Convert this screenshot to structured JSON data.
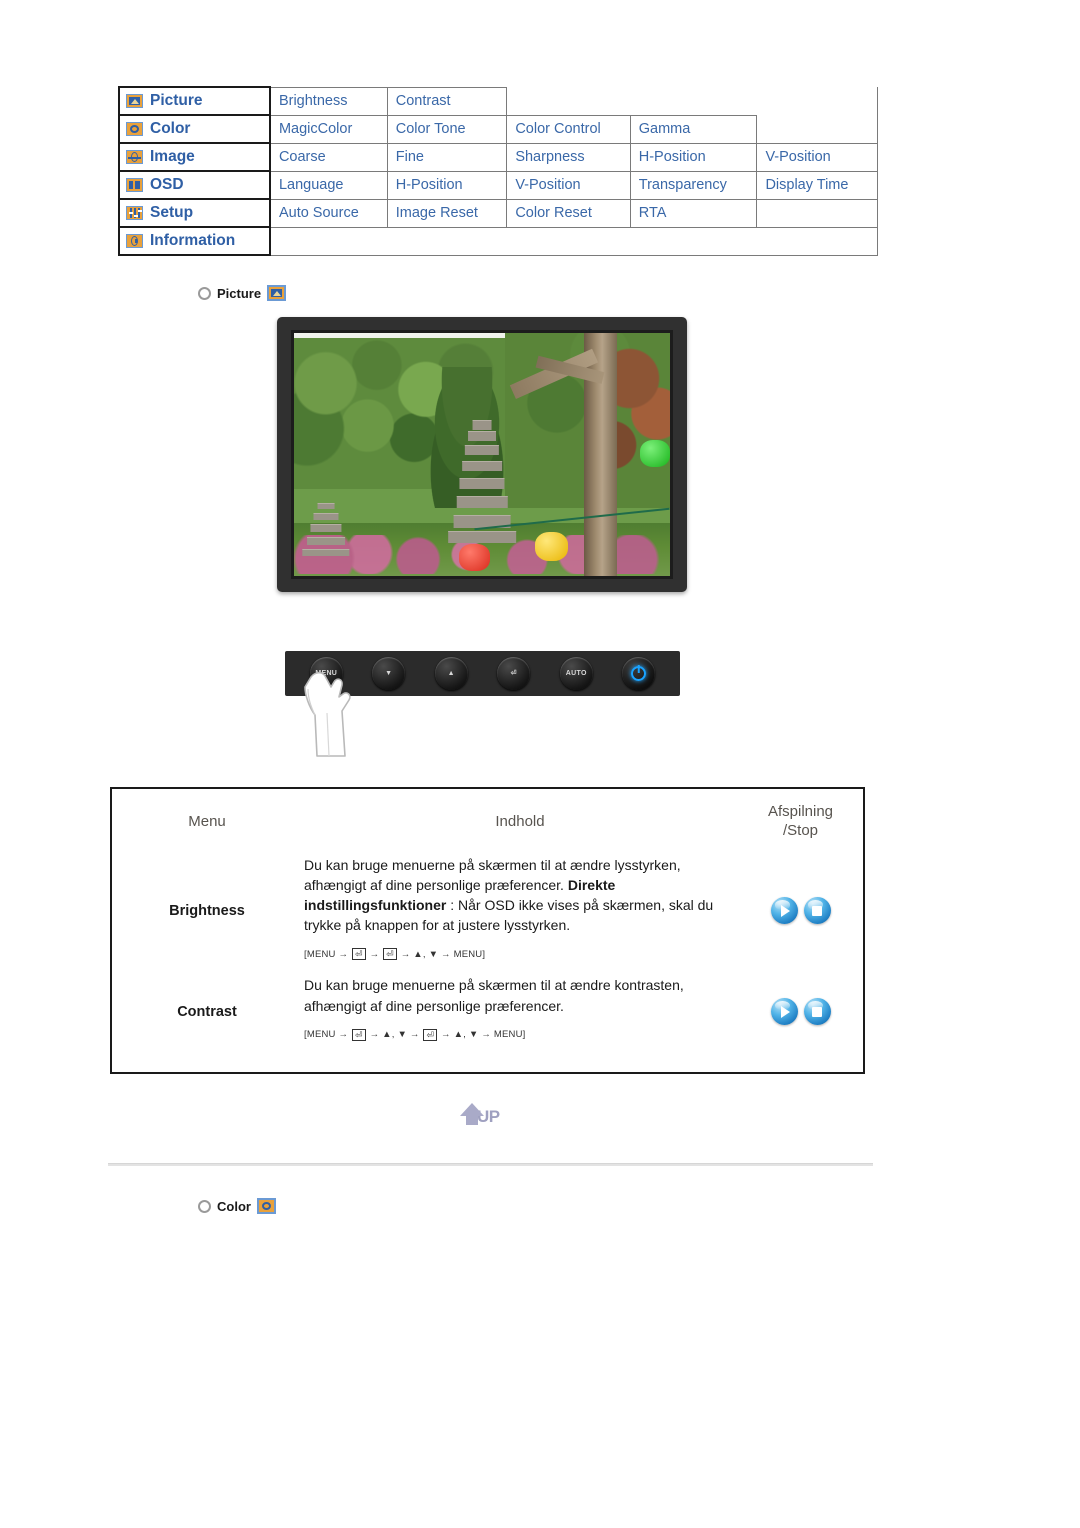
{
  "menu_map": {
    "rows": [
      {
        "icon": "picture-menu-icon",
        "category": "Picture",
        "items": [
          "Brightness",
          "Contrast"
        ]
      },
      {
        "icon": "color-menu-icon",
        "category": "Color",
        "items": [
          "MagicColor",
          "Color Tone",
          "Color Control",
          "Gamma"
        ]
      },
      {
        "icon": "image-menu-icon",
        "category": "Image",
        "items": [
          "Coarse",
          "Fine",
          "Sharpness",
          "H-Position",
          "V-Position"
        ]
      },
      {
        "icon": "osd-menu-icon",
        "category": "OSD",
        "items": [
          "Language",
          "H-Position",
          "V-Position",
          "Transparency",
          "Display Time"
        ]
      },
      {
        "icon": "setup-menu-icon",
        "category": "Setup",
        "items": [
          "Auto Source",
          "Image Reset",
          "Color Reset",
          "RTA"
        ]
      },
      {
        "icon": "information-menu-icon",
        "category": "Information",
        "items": []
      }
    ]
  },
  "section_picture": {
    "label": "Picture",
    "bullet_icon": "bullet-icon",
    "badge_icon": "picture-menu-icon"
  },
  "section_color": {
    "label": "Color",
    "bullet_icon": "bullet-icon",
    "badge_icon": "color-menu-icon"
  },
  "monitor": {
    "screen_alt": "garden-photo-with-stone-pagoda-and-paper-lanterns"
  },
  "button_bar": {
    "buttons": [
      {
        "name": "menu-button",
        "label": "MENU"
      },
      {
        "name": "down-button",
        "label": "▼"
      },
      {
        "name": "up-brightness-button",
        "label": "▲"
      },
      {
        "name": "enter-button",
        "label": "⏎"
      },
      {
        "name": "auto-button",
        "label": "AUTO"
      },
      {
        "name": "power-button",
        "label": ""
      }
    ]
  },
  "desc_table": {
    "headers": {
      "menu": "Menu",
      "content": "Indhold",
      "play_line1": "Afspilning",
      "play_line2": "/Stop"
    },
    "rows": [
      {
        "name": "Brightness",
        "text_before_bold": "Du kan bruge menuerne på skærmen til at ændre lysstyrken, afhængigt af dine personlige præferencer. ",
        "bold": "Direkte indstillingsfunktioner",
        "text_after_bold": " : Når OSD ikke vises på skærmen, skal du trykke på knappen for at justere lysstyrken.",
        "keyseq": "[MENU → ⏎ → ⏎ → ▲, ▼ → MENU]",
        "keyseq_parts": [
          "[MENU",
          "→",
          "⏎",
          "→",
          "⏎",
          "→",
          "▲, ▼",
          "→",
          "MENU]"
        ]
      },
      {
        "name": "Contrast",
        "text_before_bold": "Du kan bruge menuerne på skærmen til at ændre kontrasten, afhængigt af dine personlige præferencer.",
        "bold": "",
        "text_after_bold": "",
        "keyseq": "[MENU → ⏎ → ▲, ▼ → ⏎ → ▲, ▼ → MENU]",
        "keyseq_parts": [
          "[MENU",
          "→",
          "⏎",
          "→",
          "▲, ▼",
          "→",
          "⏎",
          "→",
          "▲, ▼",
          "→",
          "MENU]"
        ]
      }
    ],
    "play_button_label": "play-button",
    "stop_button_label": "stop-button"
  },
  "up_button": {
    "label": "UP"
  },
  "colors": {
    "link_blue": "#3a68a8",
    "category_blue": "#2f5fa5",
    "icon_orange": "#e9a13b",
    "header_gray": "#58544f",
    "orb_blue": "#52b4e8",
    "up_purple": "#9fa0c0"
  }
}
